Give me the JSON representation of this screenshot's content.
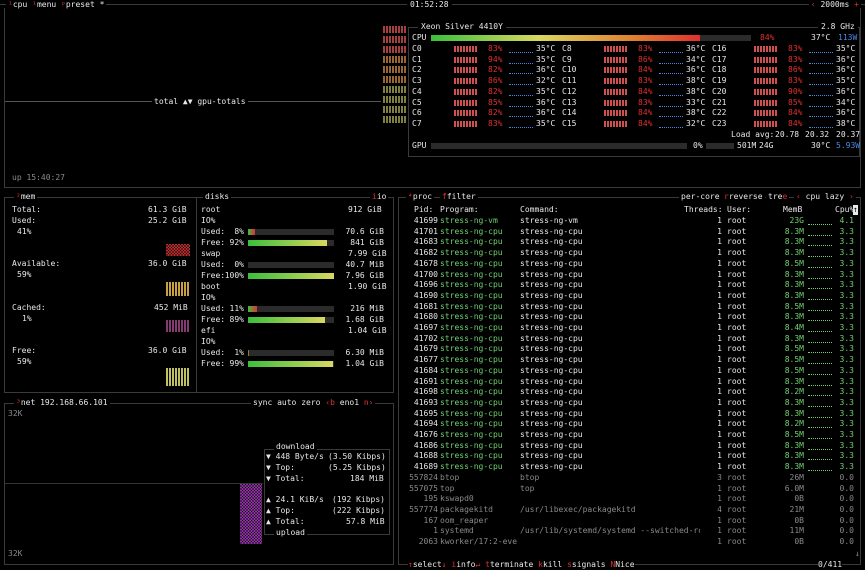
{
  "topbar": {
    "num1": "¹",
    "cpu": "cpu",
    "menu": "menu",
    "preset": "preset *",
    "clock": "01:52:28",
    "interval": "2000ms",
    "plus": "+"
  },
  "cpu_box": {
    "total_label": "total ▲▼ gpu-totals",
    "uptime": "up 15:40:27",
    "model": "Xeon Silver 4410Y",
    "freq": "2.8 GHz",
    "total": {
      "label": "CPU",
      "pct": "84%",
      "pct_value": 84,
      "temp": "37°C",
      "watts": "113W"
    },
    "cores": [
      {
        "c": "C0",
        "p": "83%",
        "t": "35°C"
      },
      {
        "c": "C1",
        "p": "94%",
        "t": "35°C"
      },
      {
        "c": "C2",
        "p": "82%",
        "t": "36°C"
      },
      {
        "c": "C3",
        "p": "86%",
        "t": "32°C"
      },
      {
        "c": "C4",
        "p": "82%",
        "t": "35°C"
      },
      {
        "c": "C5",
        "p": "85%",
        "t": "36°C"
      },
      {
        "c": "C6",
        "p": "82%",
        "t": "36°C"
      },
      {
        "c": "C7",
        "p": "83%",
        "t": "35°C"
      },
      {
        "c": "C8",
        "p": "83%",
        "t": "36°C"
      },
      {
        "c": "C9",
        "p": "86%",
        "t": "34°C"
      },
      {
        "c": "C10",
        "p": "84%",
        "t": "36°C"
      },
      {
        "c": "C11",
        "p": "83%",
        "t": "38°C"
      },
      {
        "c": "C12",
        "p": "84%",
        "t": "38°C"
      },
      {
        "c": "C13",
        "p": "83%",
        "t": "33°C"
      },
      {
        "c": "C14",
        "p": "84%",
        "t": "38°C"
      },
      {
        "c": "C15",
        "p": "84%",
        "t": "32°C"
      },
      {
        "c": "C16",
        "p": "83%",
        "t": "35°C"
      },
      {
        "c": "C17",
        "p": "83%",
        "t": "36°C"
      },
      {
        "c": "C18",
        "p": "86%",
        "t": "36°C"
      },
      {
        "c": "C19",
        "p": "83%",
        "t": "35°C"
      },
      {
        "c": "C20",
        "p": "90%",
        "t": "36°C"
      },
      {
        "c": "C21",
        "p": "85%",
        "t": "34°C"
      },
      {
        "c": "C22",
        "p": "84%",
        "t": "36°C"
      },
      {
        "c": "C23",
        "p": "84%",
        "t": "38°C"
      }
    ],
    "load_label": "Load avg:",
    "load": [
      "20.78",
      "20.32",
      "20.37"
    ],
    "gpu": {
      "label": "GPU",
      "pct": "0%",
      "mem": "501M",
      "mem_total": "24G",
      "temp": "30°C",
      "watts": "5.93W"
    }
  },
  "mem_box": {
    "num": "²",
    "title": "mem",
    "total_label": "Total:",
    "total": "61.3 GiB",
    "used_label": "Used:",
    "used": "25.2 GiB",
    "used_pct": "41%",
    "avail_label": "Available:",
    "avail": "36.0 GiB",
    "avail_pct": "59%",
    "cached_label": "Cached:",
    "cached": "452 MiB",
    "cached_pct": "1%",
    "free_label": "Free:",
    "free": "36.0 GiB",
    "free_pct": "59%"
  },
  "disks_box": {
    "title": "disks",
    "io": "io",
    "disks": [
      {
        "name": "root",
        "size": "912 GiB",
        "io": "IO%",
        "used_label": "Used:",
        "used_pct": "8%",
        "used_val": 8,
        "used": "70.6 GiB",
        "free_label": "Free:",
        "free_pct": "92%",
        "free_val": 92,
        "free": "841 GiB"
      },
      {
        "name": "swap",
        "size": "7.99 GiB",
        "io": "",
        "used_label": "Used:",
        "used_pct": "0%",
        "used_val": 0,
        "used": "40.7 MiB",
        "free_label": "Free:",
        "free_pct": "100%",
        "free_val": 100,
        "free": "7.96 GiB"
      },
      {
        "name": "boot",
        "size": "1.90 GiB",
        "io": "IO%",
        "used_label": "Used:",
        "used_pct": "11%",
        "used_val": 11,
        "used": "216 MiB",
        "free_label": "Free:",
        "free_pct": "89%",
        "free_val": 89,
        "free": "1.68 GiB"
      },
      {
        "name": "efi",
        "size": "1.04 GiB",
        "io": "IO%",
        "used_label": "Used:",
        "used_pct": "1%",
        "used_val": 1,
        "used": "6.30 MiB",
        "free_label": "Free:",
        "free_pct": "99%",
        "free_val": 99,
        "free": "1.04 GiB"
      }
    ]
  },
  "net_box": {
    "num": "³",
    "title": "net",
    "ip": "192.168.66.101",
    "sync": "sync",
    "auto": "auto",
    "zero": "zero",
    "prev": "‹b",
    "iface": "eno1",
    "next": "n›",
    "scale_top": "32K",
    "scale_bottom": "32K",
    "download_label": "download",
    "dl_rate": "448 Byte/s",
    "dl_bits": "(3.50 Kibps)",
    "dl_top_label": "Top:",
    "dl_top": "(5.25 Kibps)",
    "dl_total_label": "Total:",
    "dl_total": "184 MiB",
    "ul_rate": "24.1 KiB/s",
    "ul_bits": "(192 Kibps)",
    "ul_top_label": "Top:",
    "ul_top": "(222 Kibps)",
    "ul_total_label": "Total:",
    "ul_total": "57.8 MiB",
    "upload_label": "upload"
  },
  "proc_box": {
    "num": "⁴",
    "title": "proc",
    "filter": "filter",
    "per_core": "per-core",
    "reverse": "reverse",
    "tree": "tre",
    "sort": "cpu lazy",
    "headers": {
      "pid": "Pid:",
      "program": "Program:",
      "command": "Command:",
      "threads": "Threads:",
      "user": "User:",
      "mem": "MemB",
      "cpu": "Cpu%"
    },
    "rows": [
      {
        "pid": "41699",
        "prog": "stress-ng-vm",
        "cmd": "stress-ng-vm",
        "thr": "1",
        "user": "root",
        "mem": "23G",
        "cpu": "4.1",
        "style": "active"
      },
      {
        "pid": "41701",
        "prog": "stress-ng-cpu",
        "cmd": "stress-ng-cpu",
        "thr": "1",
        "user": "root",
        "mem": "8.3M",
        "cpu": "3.3",
        "style": "active"
      },
      {
        "pid": "41683",
        "prog": "stress-ng-cpu",
        "cmd": "stress-ng-cpu",
        "thr": "1",
        "user": "root",
        "mem": "8.3M",
        "cpu": "3.3",
        "style": "active"
      },
      {
        "pid": "41682",
        "prog": "stress-ng-cpu",
        "cmd": "stress-ng-cpu",
        "thr": "1",
        "user": "root",
        "mem": "8.3M",
        "cpu": "3.3",
        "style": "active"
      },
      {
        "pid": "41678",
        "prog": "stress-ng-cpu",
        "cmd": "stress-ng-cpu",
        "thr": "1",
        "user": "root",
        "mem": "8.5M",
        "cpu": "3.3",
        "style": "active"
      },
      {
        "pid": "41700",
        "prog": "stress-ng-cpu",
        "cmd": "stress-ng-cpu",
        "thr": "1",
        "user": "root",
        "mem": "8.3M",
        "cpu": "3.3",
        "style": "active"
      },
      {
        "pid": "41696",
        "prog": "stress-ng-cpu",
        "cmd": "stress-ng-cpu",
        "thr": "1",
        "user": "root",
        "mem": "8.3M",
        "cpu": "3.3",
        "style": "active"
      },
      {
        "pid": "41690",
        "prog": "stress-ng-cpu",
        "cmd": "stress-ng-cpu",
        "thr": "1",
        "user": "root",
        "mem": "8.3M",
        "cpu": "3.3",
        "style": "active"
      },
      {
        "pid": "41681",
        "prog": "stress-ng-cpu",
        "cmd": "stress-ng-cpu",
        "thr": "1",
        "user": "root",
        "mem": "8.5M",
        "cpu": "3.3",
        "style": "active"
      },
      {
        "pid": "41680",
        "prog": "stress-ng-cpu",
        "cmd": "stress-ng-cpu",
        "thr": "1",
        "user": "root",
        "mem": "8.3M",
        "cpu": "3.3",
        "style": "active"
      },
      {
        "pid": "41697",
        "prog": "stress-ng-cpu",
        "cmd": "stress-ng-cpu",
        "thr": "1",
        "user": "root",
        "mem": "8.4M",
        "cpu": "3.3",
        "style": "active"
      },
      {
        "pid": "41702",
        "prog": "stress-ng-cpu",
        "cmd": "stress-ng-cpu",
        "thr": "1",
        "user": "root",
        "mem": "8.3M",
        "cpu": "3.3",
        "style": "active"
      },
      {
        "pid": "41679",
        "prog": "stress-ng-cpu",
        "cmd": "stress-ng-cpu",
        "thr": "1",
        "user": "root",
        "mem": "8.5M",
        "cpu": "3.3",
        "style": "active"
      },
      {
        "pid": "41677",
        "prog": "stress-ng-cpu",
        "cmd": "stress-ng-cpu",
        "thr": "1",
        "user": "root",
        "mem": "8.5M",
        "cpu": "3.3",
        "style": "active"
      },
      {
        "pid": "41684",
        "prog": "stress-ng-cpu",
        "cmd": "stress-ng-cpu",
        "thr": "1",
        "user": "root",
        "mem": "8.5M",
        "cpu": "3.3",
        "style": "active"
      },
      {
        "pid": "41691",
        "prog": "stress-ng-cpu",
        "cmd": "stress-ng-cpu",
        "thr": "1",
        "user": "root",
        "mem": "8.3M",
        "cpu": "3.3",
        "style": "active"
      },
      {
        "pid": "41698",
        "prog": "stress-ng-cpu",
        "cmd": "stress-ng-cpu",
        "thr": "1",
        "user": "root",
        "mem": "8.2M",
        "cpu": "3.3",
        "style": "active"
      },
      {
        "pid": "41693",
        "prog": "stress-ng-cpu",
        "cmd": "stress-ng-cpu",
        "thr": "1",
        "user": "root",
        "mem": "8.3M",
        "cpu": "3.3",
        "style": "active"
      },
      {
        "pid": "41695",
        "prog": "stress-ng-cpu",
        "cmd": "stress-ng-cpu",
        "thr": "1",
        "user": "root",
        "mem": "8.3M",
        "cpu": "3.3",
        "style": "active"
      },
      {
        "pid": "41694",
        "prog": "stress-ng-cpu",
        "cmd": "stress-ng-cpu",
        "thr": "1",
        "user": "root",
        "mem": "8.2M",
        "cpu": "3.3",
        "style": "active"
      },
      {
        "pid": "41676",
        "prog": "stress-ng-cpu",
        "cmd": "stress-ng-cpu",
        "thr": "1",
        "user": "root",
        "mem": "8.5M",
        "cpu": "3.3",
        "style": "active"
      },
      {
        "pid": "41686",
        "prog": "stress-ng-cpu",
        "cmd": "stress-ng-cpu",
        "thr": "1",
        "user": "root",
        "mem": "8.3M",
        "cpu": "3.3",
        "style": "active"
      },
      {
        "pid": "41688",
        "prog": "stress-ng-cpu",
        "cmd": "stress-ng-cpu",
        "thr": "1",
        "user": "root",
        "mem": "8.3M",
        "cpu": "3.3",
        "style": "active"
      },
      {
        "pid": "41689",
        "prog": "stress-ng-cpu",
        "cmd": "stress-ng-cpu",
        "thr": "1",
        "user": "root",
        "mem": "8.3M",
        "cpu": "3.3",
        "style": "active"
      },
      {
        "pid": "557824",
        "prog": "btop",
        "cmd": "btop",
        "thr": "3",
        "user": "root",
        "mem": "26M",
        "cpu": "0.0",
        "style": "dim"
      },
      {
        "pid": "557075",
        "prog": "top",
        "cmd": "top",
        "thr": "1",
        "user": "root",
        "mem": "6.0M",
        "cpu": "0.0",
        "style": "dim"
      },
      {
        "pid": "195",
        "prog": "kswapd0",
        "cmd": "",
        "thr": "1",
        "user": "root",
        "mem": "0B",
        "cpu": "0.0",
        "style": "dim"
      },
      {
        "pid": "557774",
        "prog": "packagekitd",
        "cmd": "/usr/libexec/packagekitd",
        "thr": "4",
        "user": "root",
        "mem": "21M",
        "cpu": "0.0",
        "style": "dim"
      },
      {
        "pid": "167",
        "prog": "oom_reaper",
        "cmd": "",
        "thr": "1",
        "user": "root",
        "mem": "0B",
        "cpu": "0.0",
        "style": "dim"
      },
      {
        "pid": "1",
        "prog": "systemd",
        "cmd": "/usr/lib/systemd/systemd --switched-ro",
        "thr": "1",
        "user": "root",
        "mem": "11M",
        "cpu": "0.0",
        "style": "dim"
      },
      {
        "pid": "2063",
        "prog": "kworker/17:2-eve",
        "cmd": "",
        "thr": "1",
        "user": "root",
        "mem": "0B",
        "cpu": "0.0",
        "style": "dim"
      }
    ],
    "footer": {
      "select": "select",
      "info": "info",
      "terminate": "terminate",
      "kill": "kill",
      "signals": "signals",
      "nice": "Nice",
      "count": "0/411"
    }
  },
  "colors": {
    "accent": "#e03030",
    "text": "#d8d8d8",
    "dim": "#8a8a8a",
    "green": "#6fd16f",
    "blue": "#4a88e8",
    "border": "#3a3a3a"
  }
}
